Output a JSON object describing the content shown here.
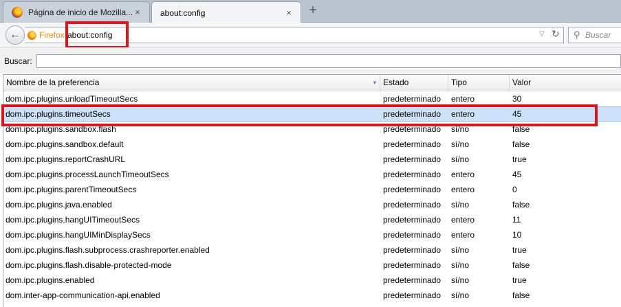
{
  "tabs": [
    {
      "label": "Página de inicio de Mozilla...",
      "close": "×",
      "active": false
    },
    {
      "label": "about:config",
      "close": "×",
      "active": true
    }
  ],
  "new_tab_label": "+",
  "nav": {
    "back_glyph": "←",
    "identity_label": "Firefox",
    "url": "about:config",
    "dropmarker_glyph": "▽",
    "reload_glyph": "↻",
    "search_placeholder": "Buscar",
    "search_glyph": "⚲"
  },
  "filter": {
    "label": "Buscar:",
    "value": ""
  },
  "columns": {
    "name": "Nombre de la preferencia",
    "state": "Estado",
    "type": "Tipo",
    "value": "Valor",
    "sort_glyph": "▼"
  },
  "rows": [
    {
      "name": "dom.ipc.plugins.unloadTimeoutSecs",
      "state": "predeterminado",
      "type": "entero",
      "value": "30",
      "selected": false
    },
    {
      "name": "dom.ipc.plugins.timeoutSecs",
      "state": "predeterminado",
      "type": "entero",
      "value": "45",
      "selected": true
    },
    {
      "name": "dom.ipc.plugins.sandbox.flash",
      "state": "predeterminado",
      "type": "sí/no",
      "value": "false",
      "selected": false
    },
    {
      "name": "dom.ipc.plugins.sandbox.default",
      "state": "predeterminado",
      "type": "sí/no",
      "value": "false",
      "selected": false
    },
    {
      "name": "dom.ipc.plugins.reportCrashURL",
      "state": "predeterminado",
      "type": "sí/no",
      "value": "true",
      "selected": false
    },
    {
      "name": "dom.ipc.plugins.processLaunchTimeoutSecs",
      "state": "predeterminado",
      "type": "entero",
      "value": "45",
      "selected": false
    },
    {
      "name": "dom.ipc.plugins.parentTimeoutSecs",
      "state": "predeterminado",
      "type": "entero",
      "value": "0",
      "selected": false
    },
    {
      "name": "dom.ipc.plugins.java.enabled",
      "state": "predeterminado",
      "type": "sí/no",
      "value": "false",
      "selected": false
    },
    {
      "name": "dom.ipc.plugins.hangUITimeoutSecs",
      "state": "predeterminado",
      "type": "entero",
      "value": "11",
      "selected": false
    },
    {
      "name": "dom.ipc.plugins.hangUIMinDisplaySecs",
      "state": "predeterminado",
      "type": "entero",
      "value": "10",
      "selected": false
    },
    {
      "name": "dom.ipc.plugins.flash.subprocess.crashreporter.enabled",
      "state": "predeterminado",
      "type": "sí/no",
      "value": "true",
      "selected": false
    },
    {
      "name": "dom.ipc.plugins.flash.disable-protected-mode",
      "state": "predeterminado",
      "type": "sí/no",
      "value": "false",
      "selected": false
    },
    {
      "name": "dom.ipc.plugins.enabled",
      "state": "predeterminado",
      "type": "sí/no",
      "value": "true",
      "selected": false
    },
    {
      "name": "dom.inter-app-communication-api.enabled",
      "state": "predeterminado",
      "type": "sí/no",
      "value": "false",
      "selected": false
    }
  ],
  "colors": {
    "annotation_red": "#d8161f",
    "selected_row": "#cde2f8",
    "tabstrip": "#b9c3cf"
  }
}
